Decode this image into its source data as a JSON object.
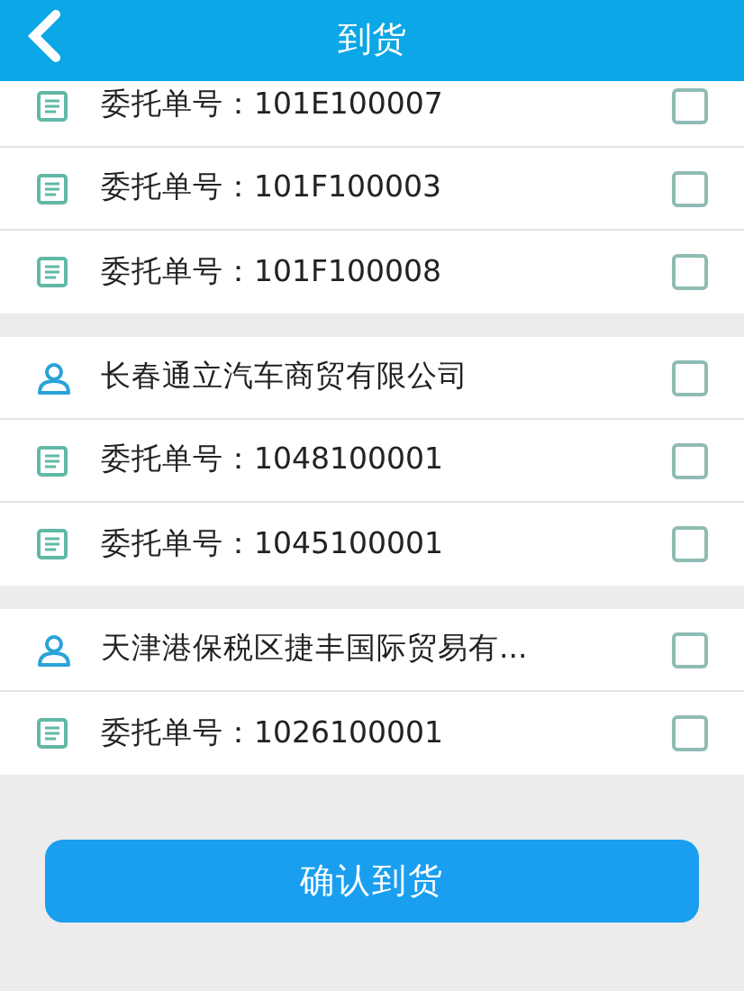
{
  "header": {
    "title": "到货"
  },
  "groups": [
    {
      "rows": [
        {
          "kind": "order",
          "text": "委托单号：101E100007",
          "checked": false
        },
        {
          "kind": "order",
          "text": "委托单号：101F100003",
          "checked": false
        },
        {
          "kind": "order",
          "text": "委托单号：101F100008",
          "checked": false
        }
      ]
    },
    {
      "rows": [
        {
          "kind": "company",
          "text": "长春通立汽车商贸有限公司",
          "checked": false
        },
        {
          "kind": "order",
          "text": "委托单号：1048100001",
          "checked": false
        },
        {
          "kind": "order",
          "text": "委托单号：1045100001",
          "checked": false
        }
      ]
    },
    {
      "rows": [
        {
          "kind": "company",
          "text": "天津港保税区捷丰国际贸易有...",
          "checked": false
        },
        {
          "kind": "order",
          "text": "委托单号：1026100001",
          "checked": false
        }
      ]
    }
  ],
  "confirm_button": "确认到货"
}
